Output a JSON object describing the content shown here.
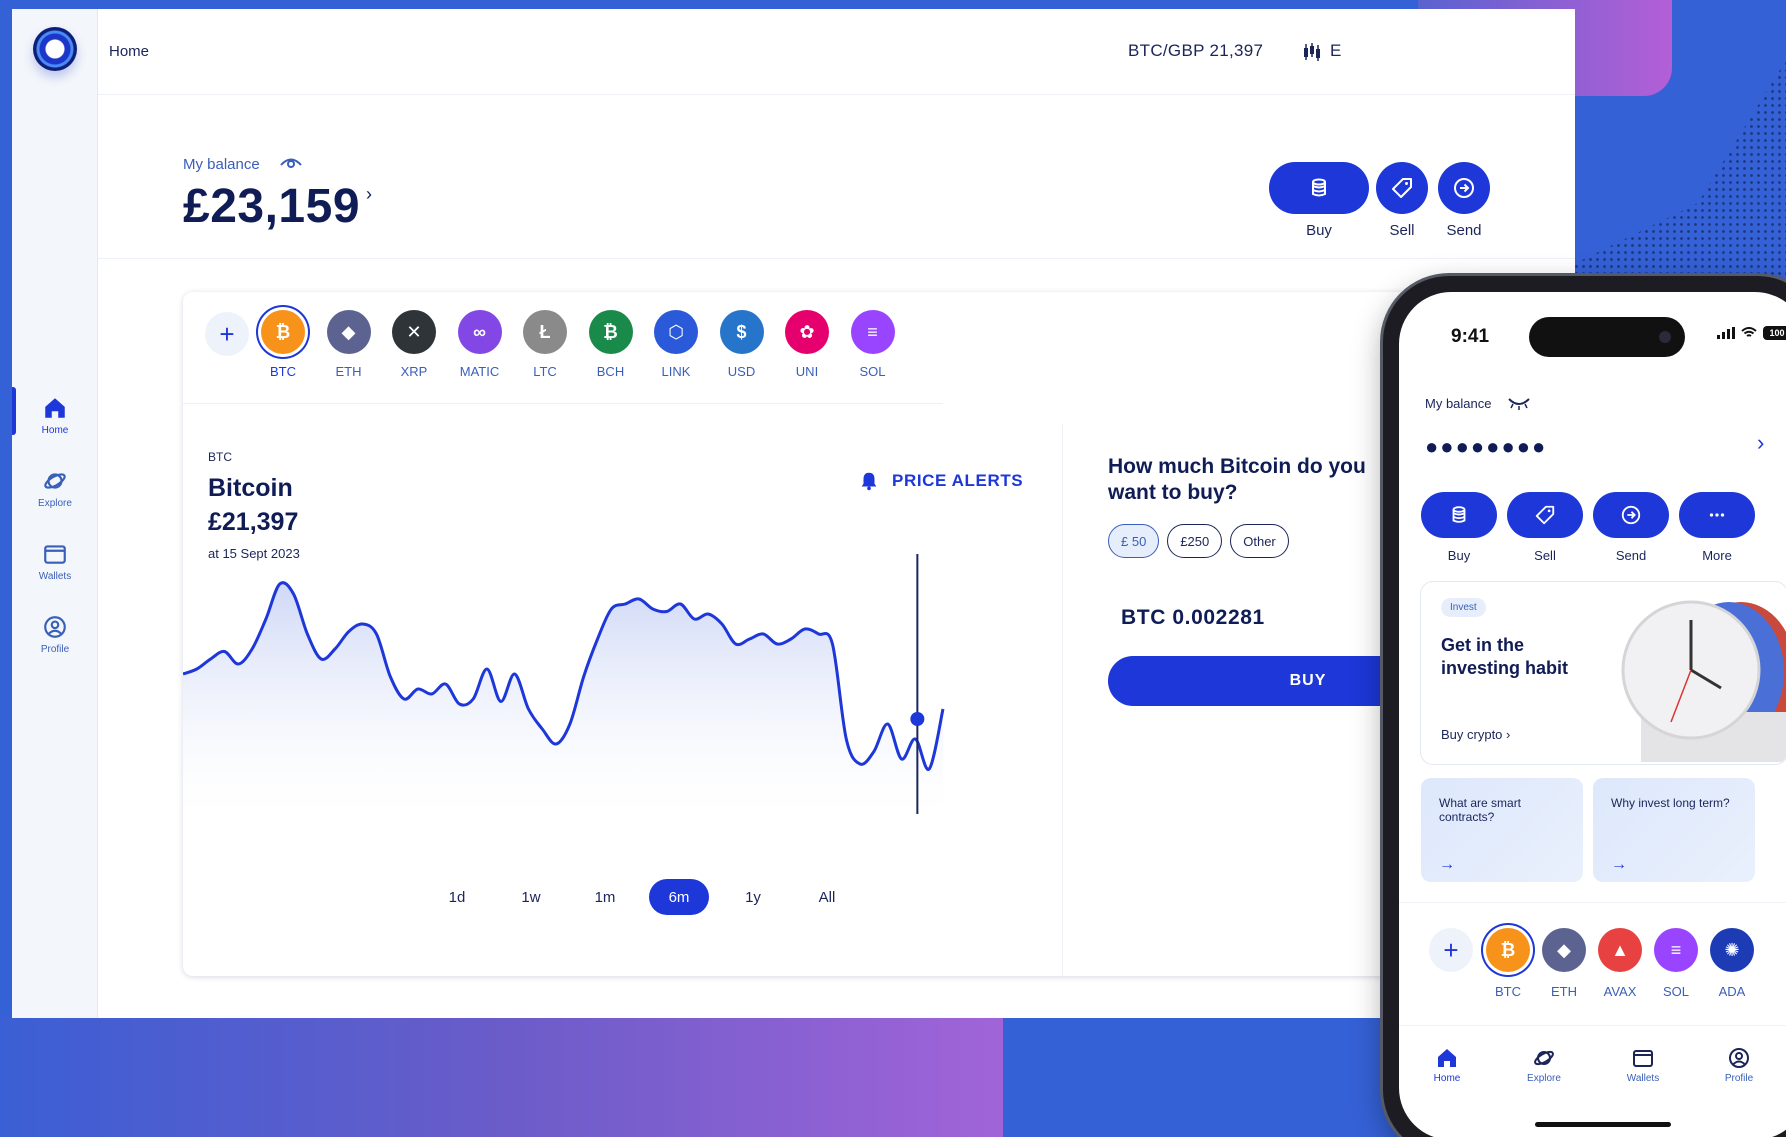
{
  "desktop": {
    "breadcrumb": "Home",
    "ticker": "BTC/GBP 21,397",
    "ticker_trailing": "E",
    "balance_label": "My balance",
    "balance_value": "£23,159",
    "actions": {
      "buy": "Buy",
      "sell": "Sell",
      "send": "Send"
    },
    "nav": [
      {
        "label": "Home",
        "icon": "home-icon",
        "active": true
      },
      {
        "label": "Explore",
        "icon": "explore-icon"
      },
      {
        "label": "Wallets",
        "icon": "wallet-icon"
      },
      {
        "label": "Profile",
        "icon": "profile-icon"
      }
    ],
    "coins": [
      {
        "ticker": "BTC",
        "color": "#f7931a",
        "glyph": "₿"
      },
      {
        "ticker": "ETH",
        "color": "#5d6390",
        "glyph": "◆"
      },
      {
        "ticker": "XRP",
        "color": "#2f3438",
        "glyph": "✕"
      },
      {
        "ticker": "MATIC",
        "color": "#8247e5",
        "glyph": "∞"
      },
      {
        "ticker": "LTC",
        "color": "#8a8a8a",
        "glyph": "Ł"
      },
      {
        "ticker": "BCH",
        "color": "#1a8a4a",
        "glyph": "₿"
      },
      {
        "ticker": "LINK",
        "color": "#2a5ada",
        "glyph": "⬡"
      },
      {
        "ticker": "USD",
        "color": "#2775ca",
        "glyph": "$"
      },
      {
        "ticker": "UNI",
        "color": "#e6006e",
        "glyph": "✿"
      },
      {
        "ticker": "SOL",
        "color": "#9945ff",
        "glyph": "≡"
      }
    ],
    "detail": {
      "ticker": "BTC",
      "name": "Bitcoin",
      "price": "£21,397",
      "date": "at 15 Sept 2023",
      "price_alerts": "PRICE ALERTS"
    },
    "timeframes": [
      "1d",
      "1w",
      "1m",
      "6m",
      "1y",
      "All"
    ],
    "active_timeframe": "6m",
    "buy_widget": {
      "question": "How much Bitcoin do you want to buy?",
      "chips": [
        "£ 50",
        "£250",
        "Other"
      ],
      "selected_chip": "£ 50",
      "amount": "BTC 0.002281",
      "buy_label": "BUY"
    }
  },
  "chart_data": {
    "type": "line",
    "series": [
      {
        "values": [
          56,
          58,
          62,
          65,
          60,
          66,
          78,
          92,
          88,
          72,
          62,
          66,
          73,
          76,
          72,
          55,
          46,
          50,
          48,
          52,
          44,
          46,
          58,
          45,
          56,
          42,
          34,
          28,
          36,
          55,
          70,
          82,
          84,
          86,
          82,
          81,
          84,
          78,
          80,
          76,
          68,
          70,
          72,
          68,
          70,
          74,
          72,
          68,
          30,
          20,
          25,
          36,
          22,
          30,
          18,
          42
        ]
      }
    ],
    "grid": false,
    "legend": "none"
  },
  "phone": {
    "time": "9:41",
    "battery": "100",
    "balance_label": "My balance",
    "balance_masked": "●●●●●●●●",
    "actions": [
      "Buy",
      "Sell",
      "Send",
      "More"
    ],
    "card": {
      "badge": "Invest",
      "title": "Get in the investing habit",
      "link": "Buy crypto"
    },
    "mini_cards": [
      {
        "title": "What are smart contracts?",
        "arrow": "→"
      },
      {
        "title": "Why invest long term?",
        "arrow": "→"
      }
    ],
    "coins": [
      {
        "ticker": "BTC",
        "color": "#f7931a",
        "glyph": "₿"
      },
      {
        "ticker": "ETH",
        "color": "#5d6390",
        "glyph": "◆"
      },
      {
        "ticker": "AVAX",
        "color": "#e84142",
        "glyph": "▲"
      },
      {
        "ticker": "SOL",
        "color": "#9945ff",
        "glyph": "≡"
      },
      {
        "ticker": "ADA",
        "color": "#1c3bb5",
        "glyph": "✺"
      }
    ],
    "tabs": [
      "Home",
      "Explore",
      "Wallets",
      "Profile"
    ]
  }
}
